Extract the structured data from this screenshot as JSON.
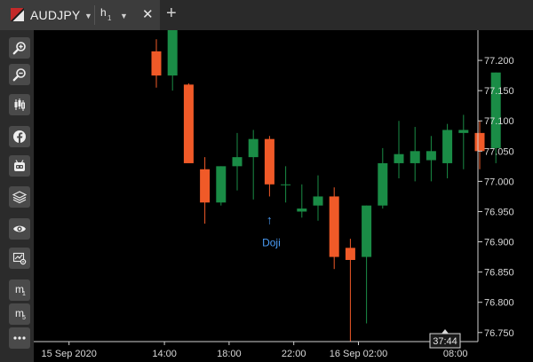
{
  "tabs": {
    "symbol": "AUDJPY",
    "timeframe": "h",
    "timeframe_sub": "1"
  },
  "sidebar": {
    "tools": [
      {
        "name": "zoom-in-icon"
      },
      {
        "name": "zoom-out-icon"
      },
      {
        "name": "candles-icon"
      },
      {
        "name": "facebook-icon"
      },
      {
        "name": "robot-icon"
      },
      {
        "name": "layers-icon"
      },
      {
        "name": "eye-icon"
      },
      {
        "name": "chart-settings-icon"
      },
      {
        "name": "m1-button",
        "label": "m",
        "sub": "1"
      },
      {
        "name": "m5-button",
        "label": "m",
        "sub": "5"
      },
      {
        "name": "more-icon"
      }
    ]
  },
  "colors": {
    "bull": "#1a8c46",
    "bear": "#f05a28",
    "axis_text": "#d8d8d8",
    "annotation": "#4a9cf5"
  },
  "chart_data": {
    "type": "candlestick",
    "ylim": [
      76.735,
      77.25
    ],
    "y_ticks": [
      "77.200",
      "77.150",
      "77.100",
      "77.050",
      "77.000",
      "76.950",
      "76.900",
      "76.850",
      "76.800",
      "76.750"
    ],
    "x_ticks": [
      {
        "label": "15 Sep 2020",
        "index": -5.4
      },
      {
        "label": "14:00",
        "index": 0.5
      },
      {
        "label": "18:00",
        "index": 4.5
      },
      {
        "label": "22:00",
        "index": 8.5
      },
      {
        "label": "16 Sep 02:00",
        "index": 12.5
      },
      {
        "label": "08:00",
        "index": 18.5
      }
    ],
    "crosshair_time": "37:44",
    "annotation": {
      "label": "Doji",
      "index": 7
    },
    "candles": [
      {
        "o": 77.215,
        "h": 77.235,
        "l": 77.155,
        "c": 77.175
      },
      {
        "o": 77.175,
        "h": 77.265,
        "l": 77.15,
        "c": 77.265
      },
      {
        "o": 77.16,
        "h": 77.162,
        "l": 77.06,
        "c": 77.03
      },
      {
        "o": 77.02,
        "h": 77.04,
        "l": 76.93,
        "c": 76.965
      },
      {
        "o": 76.965,
        "h": 77.025,
        "l": 76.96,
        "c": 77.025
      },
      {
        "o": 77.025,
        "h": 77.08,
        "l": 76.985,
        "c": 77.04
      },
      {
        "o": 77.04,
        "h": 77.085,
        "l": 76.97,
        "c": 77.07
      },
      {
        "o": 77.07,
        "h": 77.075,
        "l": 76.975,
        "c": 76.995
      },
      {
        "o": 76.995,
        "h": 77.025,
        "l": 76.965,
        "c": 76.995
      },
      {
        "o": 76.95,
        "h": 76.995,
        "l": 76.94,
        "c": 76.955
      },
      {
        "o": 76.96,
        "h": 77.01,
        "l": 76.935,
        "c": 76.975
      },
      {
        "o": 76.975,
        "h": 76.99,
        "l": 76.855,
        "c": 76.875
      },
      {
        "o": 76.89,
        "h": 76.905,
        "l": 76.735,
        "c": 76.87
      },
      {
        "o": 76.875,
        "h": 76.96,
        "l": 76.765,
        "c": 76.96
      },
      {
        "o": 76.96,
        "h": 77.055,
        "l": 76.955,
        "c": 77.03
      },
      {
        "o": 77.03,
        "h": 77.1,
        "l": 77.005,
        "c": 77.045
      },
      {
        "o": 77.03,
        "h": 77.09,
        "l": 77.0,
        "c": 77.05
      },
      {
        "o": 77.035,
        "h": 77.075,
        "l": 77.0,
        "c": 77.05
      },
      {
        "o": 77.03,
        "h": 77.095,
        "l": 77.005,
        "c": 77.085
      },
      {
        "o": 77.08,
        "h": 77.11,
        "l": 77.02,
        "c": 77.085
      },
      {
        "o": 77.08,
        "h": 77.1,
        "l": 77.02,
        "c": 77.05
      },
      {
        "o": 77.055,
        "h": 77.18,
        "l": 77.03,
        "c": 77.18
      }
    ]
  }
}
